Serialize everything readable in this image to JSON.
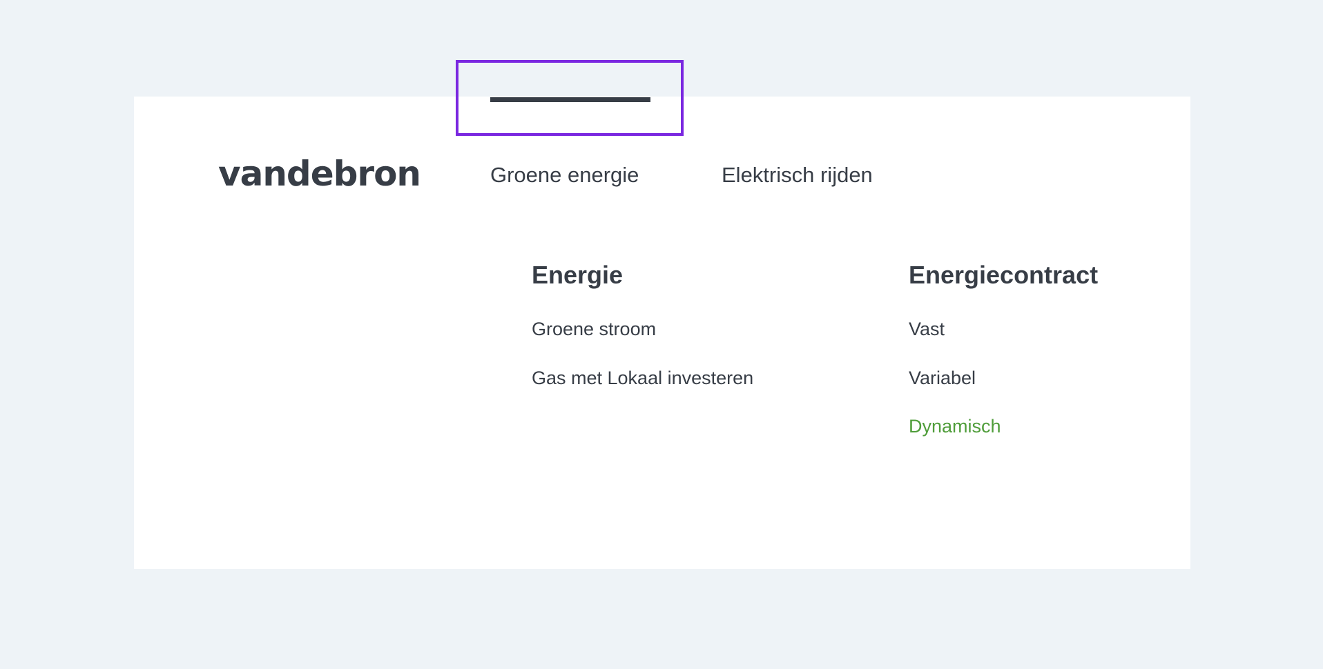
{
  "header": {
    "logo_text": "vandebron",
    "nav_items": [
      {
        "label": "Groene energie",
        "active": true
      },
      {
        "label": "Elektrisch rijden",
        "active": false
      }
    ]
  },
  "dropdown": {
    "columns": [
      {
        "heading": "Energie",
        "links": [
          "Groene stroom",
          "Gas met Lokaal investeren"
        ]
      },
      {
        "heading": "Energiecontract",
        "links": [
          "Vast",
          "Variabel",
          "Dynamisch"
        ]
      }
    ]
  },
  "colors": {
    "page_background": "#eef3f7",
    "card_background": "#ffffff",
    "text": "#373d46",
    "highlight_link": "#4f9d3a",
    "focus_outline": "#7a27e0"
  }
}
